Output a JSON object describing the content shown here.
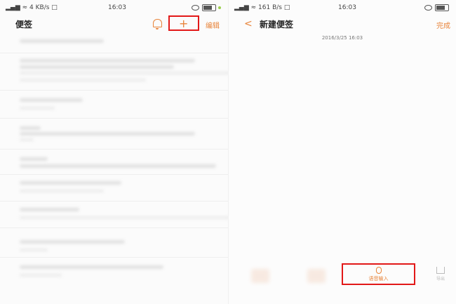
{
  "left": {
    "status": {
      "signal": "▂▄▆ ≈ 4 KB/s □",
      "time": "16:03"
    },
    "nav": {
      "title": "便签",
      "add_icon": "plus-icon",
      "edit_label": "编辑"
    }
  },
  "right": {
    "status": {
      "signal": "▂▄▆ ≈ 161 B/s □",
      "time": "16:03"
    },
    "nav": {
      "back_icon": "<",
      "title": "新建便签",
      "done_label": "完成"
    },
    "date": "2016/3/25 16:03",
    "toolbar": {
      "voice_label": "语音输入",
      "export_label": "导出"
    }
  },
  "colors": {
    "accent": "#e8843a",
    "highlight": "#e21818"
  }
}
